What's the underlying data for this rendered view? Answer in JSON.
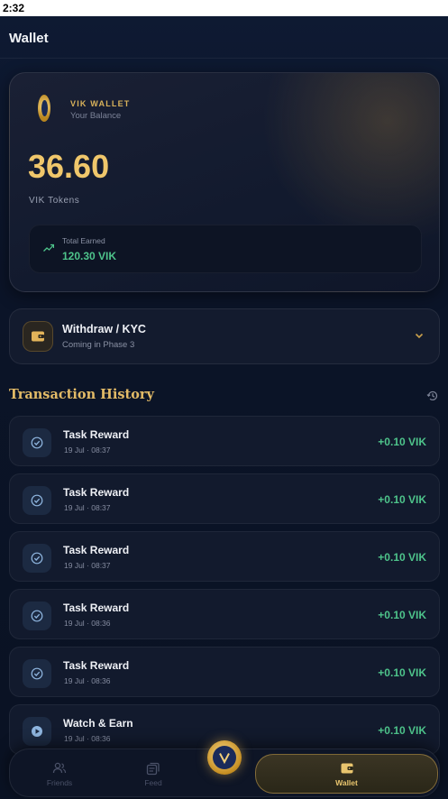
{
  "status_bar": {
    "time": "2:32"
  },
  "header": {
    "title": "Wallet"
  },
  "balance_card": {
    "brand": "VIK WALLET",
    "subtitle": "Your Balance",
    "amount": "36.60",
    "unit": "VIK Tokens",
    "total_earned_label": "Total Earned",
    "total_earned_value": "120.30 VIK"
  },
  "withdraw": {
    "title": "Withdraw / KYC",
    "subtitle": "Coming in Phase 3"
  },
  "history": {
    "title": "Transaction History",
    "items": [
      {
        "title": "Task Reward",
        "time": "19 Jul · 08:37",
        "amount": "+0.10 VIK",
        "icon": "check-circle-icon"
      },
      {
        "title": "Task Reward",
        "time": "19 Jul · 08:37",
        "amount": "+0.10 VIK",
        "icon": "check-circle-icon"
      },
      {
        "title": "Task Reward",
        "time": "19 Jul · 08:37",
        "amount": "+0.10 VIK",
        "icon": "check-circle-icon"
      },
      {
        "title": "Task Reward",
        "time": "19 Jul · 08:36",
        "amount": "+0.10 VIK",
        "icon": "check-circle-icon"
      },
      {
        "title": "Task Reward",
        "time": "19 Jul · 08:36",
        "amount": "+0.10 VIK",
        "icon": "check-circle-icon"
      },
      {
        "title": "Watch & Earn",
        "time": "19 Jul · 08:36",
        "amount": "+0.10 VIK",
        "icon": "play-circle-icon"
      }
    ]
  },
  "bottom_nav": {
    "friends": "Friends",
    "feed": "Feed",
    "wallet": "Wallet"
  },
  "colors": {
    "gold": "#f0c76b",
    "positive": "#4ec48b",
    "background": "#0b1326"
  }
}
